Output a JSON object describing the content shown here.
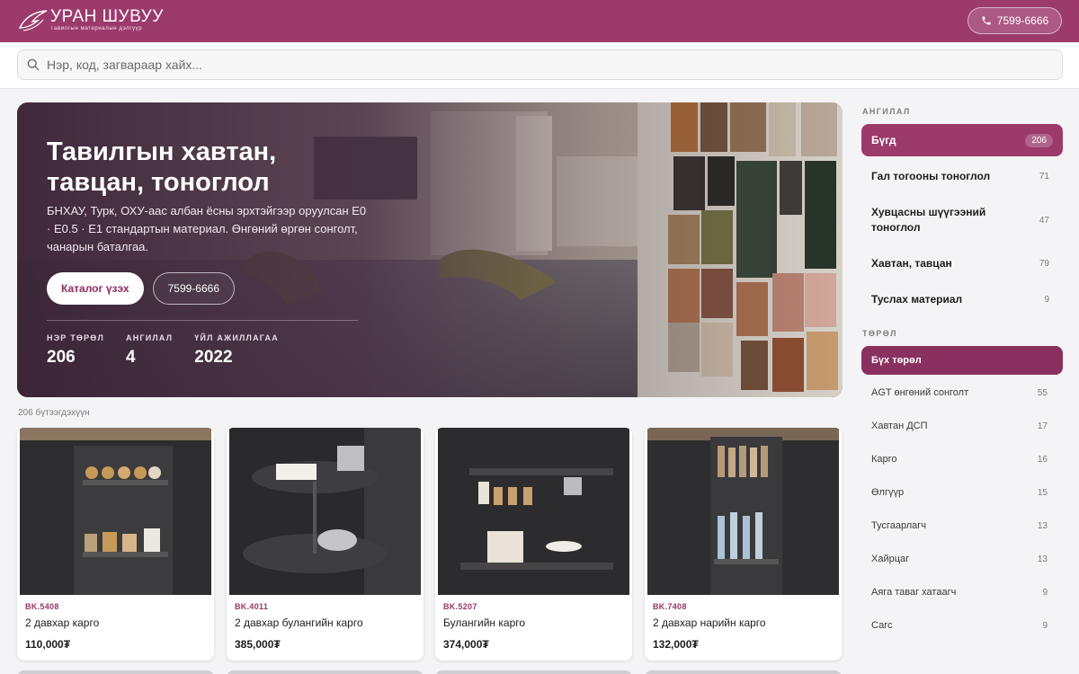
{
  "header": {
    "logo_title": "УРАН ШУВУУ",
    "logo_subtitle": "Тавилгын материалын дэлгүүр",
    "phone": "7599-6666"
  },
  "search": {
    "placeholder": "Нэр, код, загвараар хайх..."
  },
  "hero": {
    "title_line1": "Тавилгын хавтан,",
    "title_line2": "тавцан, тоноглол",
    "description": "БНХАУ, Турк, ОХУ-аас албан ёсны эрхтэйгээр оруулсан E0 · E0.5 · E1 стандартын материал. Өнгөний өргөн сонголт, чанарын баталгаа.",
    "primary_button": "Каталог үзэх",
    "secondary_button": "7599-6666",
    "stats": [
      {
        "label": "НЭР ТӨРӨЛ",
        "value": "206"
      },
      {
        "label": "АНГИЛАЛ",
        "value": "4"
      },
      {
        "label": "ҮЙЛ АЖИЛЛАГАА",
        "value": "2022"
      }
    ]
  },
  "results": {
    "count_text": "206 бүтээгдэхүүн"
  },
  "products": [
    {
      "code": "BK.5408",
      "name": "2 давхар карго",
      "price": "110,000₮"
    },
    {
      "code": "BK.4011",
      "name": "2 давхар булангийн карго",
      "price": "385,000₮"
    },
    {
      "code": "BK.5207",
      "name": "Булангийн карго",
      "price": "374,000₮"
    },
    {
      "code": "BK.7408",
      "name": "2 давхар нарийн карго",
      "price": "132,000₮"
    }
  ],
  "sidebar": {
    "categories_heading": "АНГИЛАЛ",
    "categories": [
      {
        "label": "Бүгд",
        "count": "206"
      },
      {
        "label": "Гал тогооны тоноглол",
        "count": "71"
      },
      {
        "label": "Хувцасны шүүгээний тоноглол",
        "count": "47"
      },
      {
        "label": "Хавтан, тавцан",
        "count": "79"
      },
      {
        "label": "Туслах материал",
        "count": "9"
      }
    ],
    "types_heading": "ТӨРӨЛ",
    "types": [
      {
        "label": "Бүх төрөл",
        "count": ""
      },
      {
        "label": "AGT өнгөний сонголт",
        "count": "55"
      },
      {
        "label": "Хавтан ДСП",
        "count": "17"
      },
      {
        "label": "Карго",
        "count": "16"
      },
      {
        "label": "Өлгүүр",
        "count": "15"
      },
      {
        "label": "Тусгаарлагч",
        "count": "13"
      },
      {
        "label": "Хайрцаг",
        "count": "13"
      },
      {
        "label": "Аяга таваг хатаагч",
        "count": "9"
      },
      {
        "label": "Сагс",
        "count": "9"
      }
    ]
  },
  "colors": {
    "brand": "#9c3a6c",
    "brand_dark": "#8a3060"
  }
}
